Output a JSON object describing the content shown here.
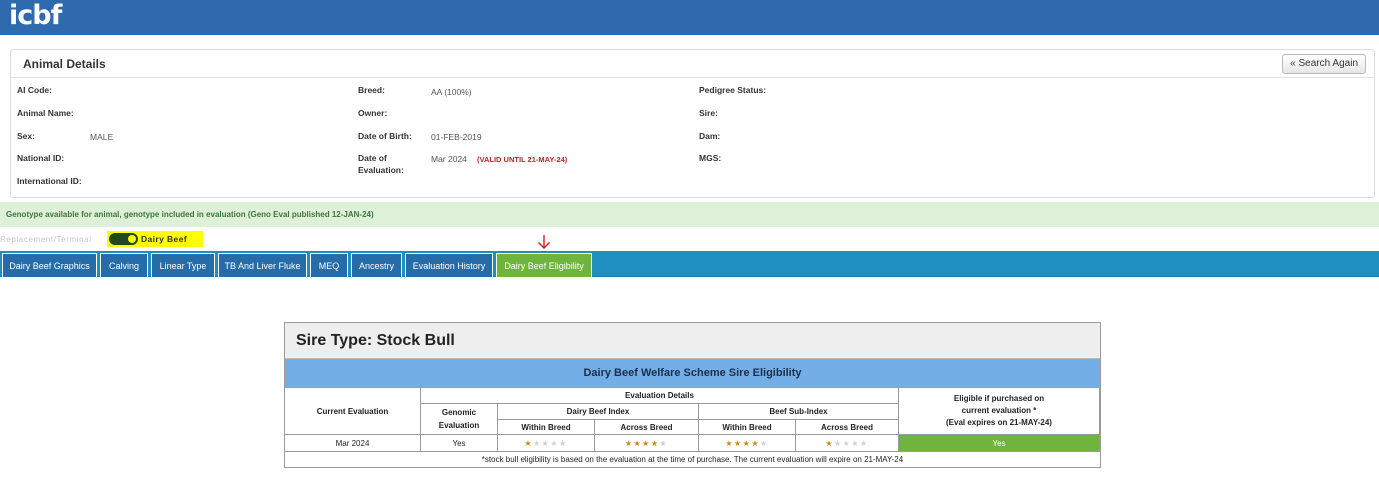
{
  "header": {
    "logo": "icbf"
  },
  "animal_details": {
    "title": "Animal Details",
    "search_again": "« Search Again",
    "fields": {
      "ai_code": {
        "label": "AI Code:",
        "value": ""
      },
      "animal_name": {
        "label": "Animal Name:",
        "value": ""
      },
      "sex": {
        "label": "Sex:",
        "value": "MALE"
      },
      "national_id": {
        "label": "National ID:",
        "value": ""
      },
      "international_id": {
        "label": "International ID:",
        "value": ""
      },
      "breed": {
        "label": "Breed:",
        "value": "AA (100%)"
      },
      "owner": {
        "label": "Owner:",
        "value": ""
      },
      "dob": {
        "label": "Date of Birth:",
        "value": "01-FEB-2019"
      },
      "date_eval_1": {
        "label": "Date of",
        "value": "Mar 2024"
      },
      "date_eval_2": {
        "label": "Evaluation:"
      },
      "valid_until": "(VALID UNTIL 21-MAY-24)",
      "pedigree_status": {
        "label": "Pedigree Status:",
        "value": ""
      },
      "sire": {
        "label": "Sire:",
        "value": ""
      },
      "dam": {
        "label": "Dam:",
        "value": ""
      },
      "mgs": {
        "label": "MGS:",
        "value": ""
      }
    }
  },
  "genotype_notice": "Genotype available for animal, genotype included in evaluation (Geno Eval published 12-JAN-24)",
  "toggle": {
    "left_label": "Replacement/Terminal",
    "right_label": "Dairy Beef",
    "highlight_color": "#ffff00"
  },
  "tabs": [
    {
      "label": "Dairy Beef Graphics",
      "active": false
    },
    {
      "label": "Calving",
      "active": false
    },
    {
      "label": "Linear Type",
      "active": false
    },
    {
      "label": "TB And Liver Fluke",
      "active": false
    },
    {
      "label": "MEQ",
      "active": false
    },
    {
      "label": "Ancestry",
      "active": false
    },
    {
      "label": "Evaluation History",
      "active": false
    },
    {
      "label": "Dairy Beef Eligibility",
      "active": true
    }
  ],
  "eligibility": {
    "sire_type": "Sire Type: Stock Bull",
    "scheme_title": "Dairy Beef Welfare Scheme Sire Eligibility",
    "headers": {
      "current_evaluation": "Current Evaluation",
      "evaluation_details": "Evaluation Details",
      "genomic_1": "Genomic",
      "genomic_2": "Evaluation",
      "dairy_beef_index": "Dairy Beef Index",
      "beef_sub_index": "Beef Sub-Index",
      "within_breed": "Within Breed",
      "across_breed": "Across Breed",
      "eligible_1": "Eligible if purchased on",
      "eligible_2": "current evaluation *",
      "eligible_3": "(Eval expires on 21-MAY-24)"
    },
    "row": {
      "current_evaluation": "Mar 2024",
      "genomic": "Yes",
      "dbi_within_stars": 1,
      "dbi_across_stars": 4,
      "bsi_within_stars": 4,
      "bsi_across_stars": 1,
      "max_stars": 5,
      "eligible": "Yes"
    },
    "footnote": "*stock bull eligibility is based on the evaluation at the time of purchase. The current evaluation will expire on 21-MAY-24"
  },
  "colors": {
    "header_blue": "#2e6aad",
    "tab_bar": "#1f8fbf",
    "tab_active": "#6fb43c",
    "scheme_blue": "#74aee6",
    "eligible_green": "#6fb43c",
    "star_gold": "#c98a16"
  }
}
